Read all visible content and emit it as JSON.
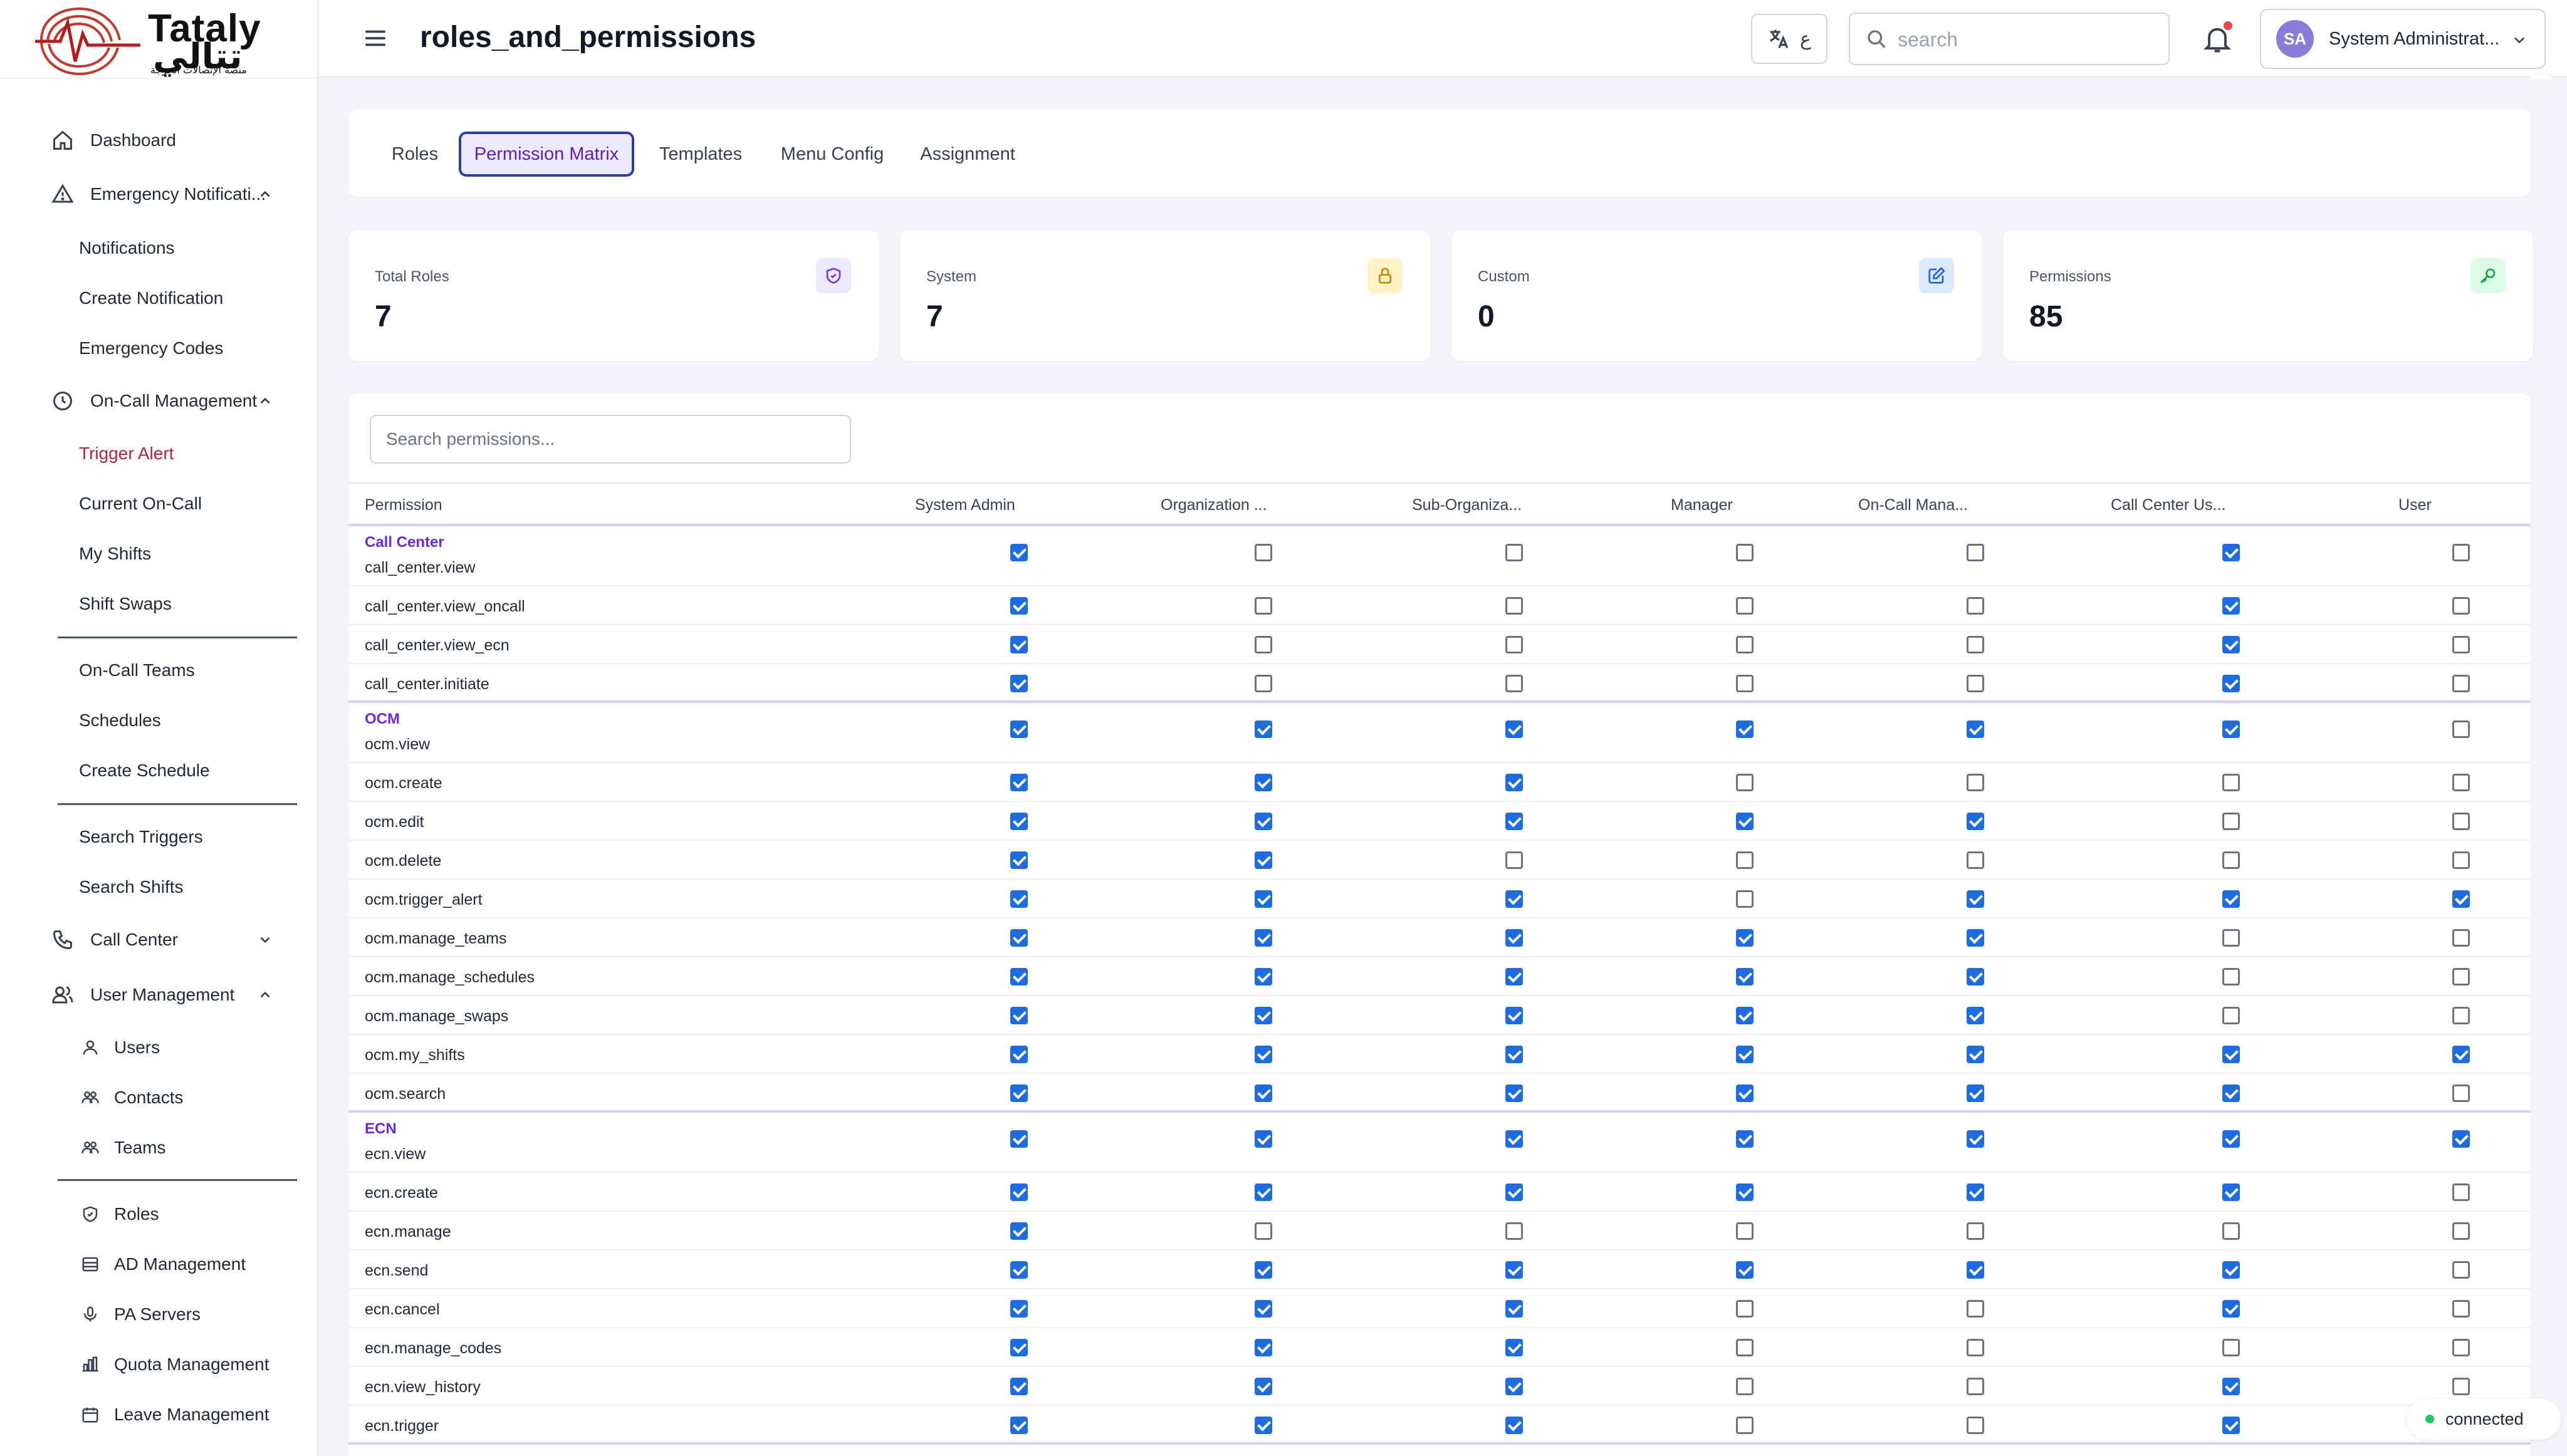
{
  "logo": {
    "name_en": "Tataly",
    "name_ar": "تتالي",
    "subtitle_ar": "منصة الإتصالات الحرجة"
  },
  "sidebar": {
    "items": [
      {
        "label": "Dashboard",
        "icon": "home-icon",
        "chevron": ""
      },
      {
        "label": "Emergency Notificati...",
        "icon": "warning-triangle-icon",
        "chevron": "up"
      },
      {
        "label": "Notifications",
        "icon": "",
        "chevron": ""
      },
      {
        "label": "Create Notification",
        "icon": "",
        "chevron": ""
      },
      {
        "label": "Emergency Codes",
        "icon": "",
        "chevron": ""
      },
      {
        "label": "On-Call Management",
        "icon": "clock-icon",
        "chevron": "up"
      },
      {
        "label": "Trigger Alert",
        "icon": "",
        "chevron": "",
        "active": true
      },
      {
        "label": "Current On-Call",
        "icon": "",
        "chevron": ""
      },
      {
        "label": "My Shifts",
        "icon": "",
        "chevron": ""
      },
      {
        "label": "Shift Swaps",
        "icon": "",
        "chevron": ""
      },
      {
        "label": "On-Call Teams",
        "icon": "",
        "chevron": ""
      },
      {
        "label": "Schedules",
        "icon": "",
        "chevron": ""
      },
      {
        "label": "Create Schedule",
        "icon": "",
        "chevron": ""
      },
      {
        "label": "Search Triggers",
        "icon": "",
        "chevron": ""
      },
      {
        "label": "Search Shifts",
        "icon": "",
        "chevron": ""
      },
      {
        "label": "Call Center",
        "icon": "phone-icon",
        "chevron": "down"
      },
      {
        "label": "User Management",
        "icon": "users-icon",
        "chevron": "up"
      },
      {
        "label": "Users",
        "icon": "user-icon",
        "chevron": ""
      },
      {
        "label": "Contacts",
        "icon": "contacts-icon",
        "chevron": ""
      },
      {
        "label": "Teams",
        "icon": "team-icon",
        "chevron": ""
      },
      {
        "label": "Roles",
        "icon": "shield-icon",
        "chevron": ""
      },
      {
        "label": "AD Management",
        "icon": "database-icon",
        "chevron": ""
      },
      {
        "label": "PA Servers",
        "icon": "microphone-icon",
        "chevron": ""
      },
      {
        "label": "Quota Management",
        "icon": "bar-chart-icon",
        "chevron": ""
      },
      {
        "label": "Leave Management",
        "icon": "calendar-icon",
        "chevron": ""
      }
    ]
  },
  "header": {
    "title": "roles_and_permissions",
    "lang_glyph": "ع",
    "search_placeholder": "search",
    "user_initials": "SA",
    "user_name": "System Administrat..."
  },
  "tabs": [
    {
      "label": "Roles",
      "active": false
    },
    {
      "label": "Permission Matrix",
      "active": true
    },
    {
      "label": "Templates",
      "active": false
    },
    {
      "label": "Menu Config",
      "active": false
    },
    {
      "label": "Assignment",
      "active": false
    }
  ],
  "stats": [
    {
      "label": "Total Roles",
      "value": "7",
      "icon": "shield-check-icon",
      "color": "#7c3aed",
      "bg": "#ede9fe"
    },
    {
      "label": "System",
      "value": "7",
      "icon": "lock-icon",
      "color": "#ca8a04",
      "bg": "#fef3c7"
    },
    {
      "label": "Custom",
      "value": "0",
      "icon": "edit-icon",
      "color": "#2563eb",
      "bg": "#dbeafe"
    },
    {
      "label": "Permissions",
      "value": "85",
      "icon": "key-icon",
      "color": "#16a34a",
      "bg": "#dcfce7"
    }
  ],
  "matrix": {
    "search_placeholder": "Search permissions...",
    "columns": [
      "Permission",
      "System Admin",
      "Organization ...",
      "Sub-Organiza...",
      "Manager",
      "On-Call Mana...",
      "Call Center Us...",
      "User"
    ],
    "groups": [
      {
        "name": "Call Center",
        "rows": [
          {
            "perm": "call_center.view",
            "values": [
              1,
              0,
              0,
              0,
              0,
              1,
              0
            ]
          },
          {
            "perm": "call_center.view_oncall",
            "values": [
              1,
              0,
              0,
              0,
              0,
              1,
              0
            ]
          },
          {
            "perm": "call_center.view_ecn",
            "values": [
              1,
              0,
              0,
              0,
              0,
              1,
              0
            ]
          },
          {
            "perm": "call_center.initiate",
            "values": [
              1,
              0,
              0,
              0,
              0,
              1,
              0
            ]
          }
        ]
      },
      {
        "name": "OCM",
        "rows": [
          {
            "perm": "ocm.view",
            "values": [
              1,
              1,
              1,
              1,
              1,
              1,
              0
            ]
          },
          {
            "perm": "ocm.create",
            "values": [
              1,
              1,
              1,
              0,
              0,
              0,
              0
            ]
          },
          {
            "perm": "ocm.edit",
            "values": [
              1,
              1,
              1,
              1,
              1,
              0,
              0
            ]
          },
          {
            "perm": "ocm.delete",
            "values": [
              1,
              1,
              0,
              0,
              0,
              0,
              0
            ]
          },
          {
            "perm": "ocm.trigger_alert",
            "values": [
              1,
              1,
              1,
              0,
              1,
              1,
              1
            ]
          },
          {
            "perm": "ocm.manage_teams",
            "values": [
              1,
              1,
              1,
              1,
              1,
              0,
              0
            ]
          },
          {
            "perm": "ocm.manage_schedules",
            "values": [
              1,
              1,
              1,
              1,
              1,
              0,
              0
            ]
          },
          {
            "perm": "ocm.manage_swaps",
            "values": [
              1,
              1,
              1,
              1,
              1,
              0,
              0
            ]
          },
          {
            "perm": "ocm.my_shifts",
            "values": [
              1,
              1,
              1,
              1,
              1,
              1,
              1
            ]
          },
          {
            "perm": "ocm.search",
            "values": [
              1,
              1,
              1,
              1,
              1,
              1,
              0
            ]
          }
        ]
      },
      {
        "name": "ECN",
        "rows": [
          {
            "perm": "ecn.view",
            "values": [
              1,
              1,
              1,
              1,
              1,
              1,
              1
            ]
          },
          {
            "perm": "ecn.create",
            "values": [
              1,
              1,
              1,
              1,
              1,
              1,
              0
            ]
          },
          {
            "perm": "ecn.manage",
            "values": [
              1,
              0,
              0,
              0,
              0,
              0,
              0
            ]
          },
          {
            "perm": "ecn.send",
            "values": [
              1,
              1,
              1,
              1,
              1,
              1,
              0
            ]
          },
          {
            "perm": "ecn.cancel",
            "values": [
              1,
              1,
              1,
              0,
              0,
              1,
              0
            ]
          },
          {
            "perm": "ecn.manage_codes",
            "values": [
              1,
              1,
              1,
              0,
              0,
              0,
              0
            ]
          },
          {
            "perm": "ecn.view_history",
            "values": [
              1,
              1,
              1,
              0,
              0,
              1,
              0
            ]
          },
          {
            "perm": "ecn.trigger",
            "values": [
              1,
              1,
              1,
              0,
              0,
              1,
              0
            ]
          }
        ]
      }
    ]
  },
  "status": {
    "label": "connected",
    "color": "#22c55e"
  }
}
